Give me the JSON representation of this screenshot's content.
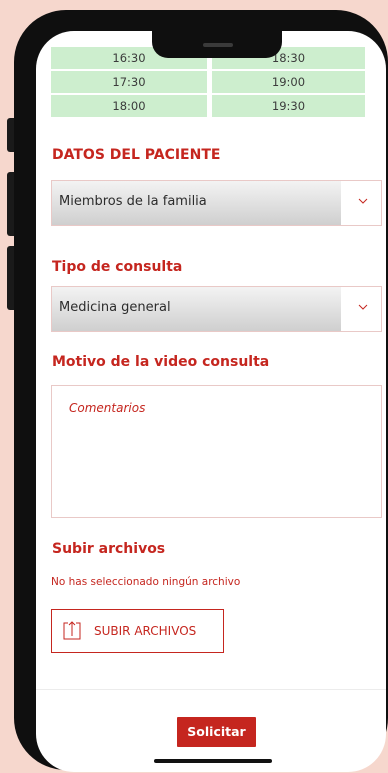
{
  "slots": {
    "left": [
      "16:30",
      "17:30",
      "18:00"
    ],
    "right": [
      "18:30",
      "19:00",
      "19:30"
    ]
  },
  "patient_section": {
    "title": "DATOS DEL PACIENTE",
    "select_value": "Miembros de la familia",
    "chevron_icon": "chevron-down-icon"
  },
  "consult_section": {
    "title": "Tipo de consulta",
    "select_value": "Medicina general",
    "chevron_icon": "chevron-down-icon"
  },
  "reason_section": {
    "title": "Motivo de la video consulta",
    "placeholder": "Comentarios"
  },
  "upload_section": {
    "title": "Subir archivos",
    "status": "No has seleccionado ningún archivo",
    "button_label": "SUBIR ARCHIVOS",
    "button_icon": "upload-icon"
  },
  "submit": {
    "label": "Solicitar"
  },
  "colors": {
    "accent": "#c5261f",
    "slot_bg": "#cdeece",
    "page_bg": "#f6d7cd"
  }
}
